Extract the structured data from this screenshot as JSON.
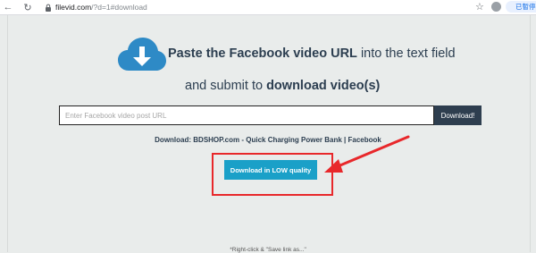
{
  "browser": {
    "url_host": "filevid.com",
    "url_path": "/?d=1#download",
    "profile_label": "已暫停"
  },
  "header": {
    "line1_bold": "Paste the Facebook video URL",
    "line1_rest": " into the text field",
    "line2_prefix": "and submit to ",
    "line2_bold": "download video(s)"
  },
  "form": {
    "input_placeholder": "Enter Facebook video post URL",
    "input_value": "",
    "submit_label": "Download!"
  },
  "result": {
    "title": "Download: BDSHOP.com - Quick Charging Power Bank | Facebook",
    "download_low_label": "Download in LOW quality",
    "hint": "*Right-click & \"Save link as...\""
  },
  "colors": {
    "cloud": "#2e8ac6",
    "primary_button": "#1aa0c8",
    "dark_button": "#2e3e4f",
    "annotation": "#e8282b"
  },
  "icons": [
    "back-arrow-icon",
    "reload-icon",
    "lock-icon",
    "bookmark-star-icon",
    "cloud-download-icon",
    "annotation-arrow-icon"
  ]
}
